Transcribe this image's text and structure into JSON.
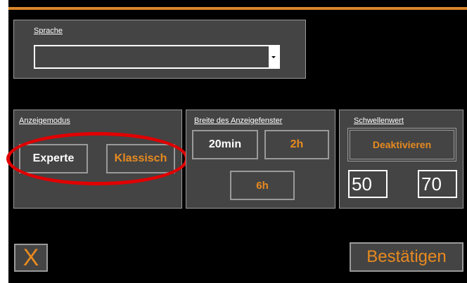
{
  "language": {
    "title": "Sprache",
    "selected_value": ""
  },
  "display_mode": {
    "title": "Anzeigemodus",
    "buttons": [
      "Experte",
      "Klassisch"
    ]
  },
  "window_width": {
    "title": "Breite des Anzeigefenster",
    "buttons": [
      "20min",
      "2h",
      "6h"
    ]
  },
  "threshold": {
    "title": "Schwellenwert",
    "deactivate_label": "Deaktivieren",
    "low_value": "50",
    "high_value": "70"
  },
  "footer": {
    "cancel_label": "X",
    "confirm_label": "Bestätigen"
  },
  "colors": {
    "accent": "#e88a1f",
    "panel": "#444444",
    "highlight_oval": "#e00000"
  },
  "icons": {
    "dropdown": "chevron-down-icon"
  }
}
